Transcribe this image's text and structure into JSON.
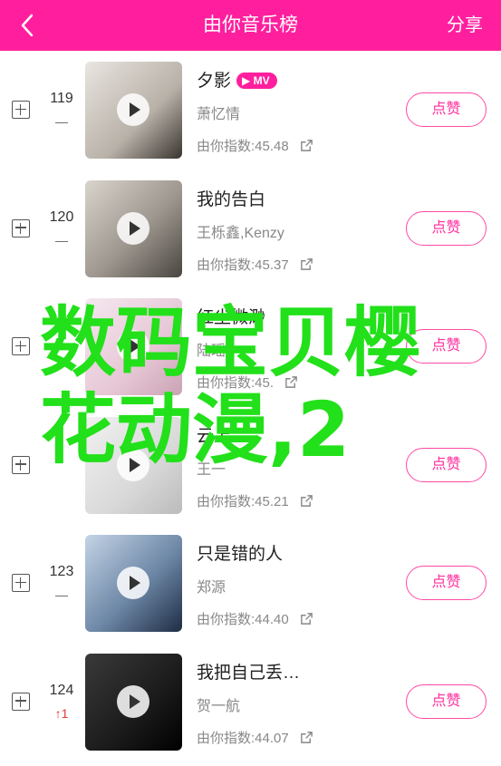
{
  "header": {
    "title": "由你音乐榜",
    "share_label": "分享"
  },
  "songs": [
    {
      "rank": "119",
      "trend": "—",
      "trend_dir": "same",
      "title": "夕影",
      "mv": "MV",
      "artist": "萧忆情",
      "index": "由你指数:45.48",
      "like": "点赞",
      "cover_bg": "linear-gradient(135deg,#e9e5e0,#b8b1a8 60%,#3a3430)"
    },
    {
      "rank": "120",
      "trend": "—",
      "trend_dir": "same",
      "title": "我的告白",
      "mv": "",
      "artist": "王栎鑫,Kenzy",
      "index": "由你指数:45.37",
      "like": "点赞",
      "cover_bg": "linear-gradient(135deg,#d9d4cc,#9c968e 55%,#4a4540)"
    },
    {
      "rank": "",
      "trend": "",
      "trend_dir": "same",
      "title": "红尘微渺",
      "mv": "",
      "artist": "陆瑶",
      "index": "由你指数:45.",
      "like": "点赞",
      "cover_bg": "linear-gradient(135deg,#f5e8ef,#e7c7d6 60%,#caa3b4)"
    },
    {
      "rank": "",
      "trend": "",
      "trend_dir": "same",
      "title": "云上",
      "mv": "",
      "artist": "王一",
      "index": "由你指数:45.21",
      "like": "点赞",
      "cover_bg": "linear-gradient(135deg,#f1f1f1,#d9d9d9 60%,#bbbbbb)"
    },
    {
      "rank": "123",
      "trend": "—",
      "trend_dir": "same",
      "title": "只是错的人",
      "mv": "",
      "artist": "郑源",
      "index": "由你指数:44.40",
      "like": "点赞",
      "cover_bg": "linear-gradient(135deg,#c4d4e6,#6d87a6 55%,#1e2d44)"
    },
    {
      "rank": "124",
      "trend": "↑1",
      "trend_dir": "up",
      "title": "我把自己丢…",
      "mv": "",
      "artist": "贺一航",
      "index": "由你指数:44.07",
      "like": "点赞",
      "cover_bg": "linear-gradient(135deg,#3a3a3a,#1a1a1a 60%,#000000)"
    }
  ],
  "overlay": {
    "line1": "数码宝贝樱",
    "line2": "花动漫,2"
  },
  "colors": {
    "accent": "#ff1f9e",
    "overlay_text": "#22e01a"
  },
  "icons": {
    "back": "chevron-left-icon",
    "add": "add-square-icon",
    "play": "play-icon",
    "external": "external-link-icon"
  }
}
